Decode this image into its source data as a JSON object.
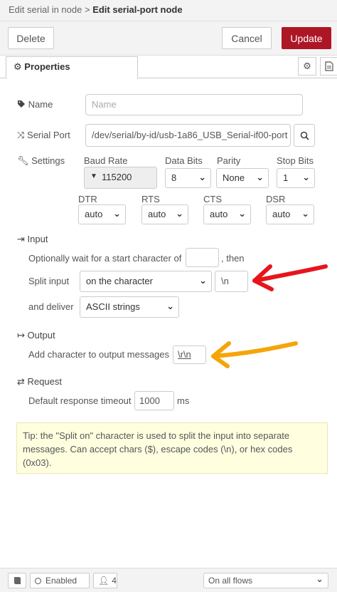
{
  "breadcrumb": {
    "parent": "Edit serial in node",
    "separator": ">",
    "current": "Edit serial-port node"
  },
  "toolbar": {
    "delete_label": "Delete",
    "cancel_label": "Cancel",
    "update_label": "Update"
  },
  "tabs": {
    "properties_label": "Properties"
  },
  "name": {
    "label": "Name",
    "placeholder": "Name",
    "value": ""
  },
  "serial_port": {
    "label": "Serial Port",
    "value": "/dev/serial/by-id/usb-1a86_USB_Serial-if00-port"
  },
  "settings": {
    "label": "Settings",
    "baud_rate": {
      "label": "Baud Rate",
      "value": "115200"
    },
    "data_bits": {
      "label": "Data Bits",
      "value": "8"
    },
    "parity": {
      "label": "Parity",
      "value": "None"
    },
    "stop_bits": {
      "label": "Stop Bits",
      "value": "1"
    },
    "dtr": {
      "label": "DTR",
      "value": "auto"
    },
    "rts": {
      "label": "RTS",
      "value": "auto"
    },
    "cts": {
      "label": "CTS",
      "value": "auto"
    },
    "dsr": {
      "label": "DSR",
      "value": "auto"
    }
  },
  "input": {
    "heading": "Input",
    "wait_prefix": "Optionally wait for a start character of",
    "wait_suffix": ", then",
    "wait_value": "",
    "split_label": "Split input",
    "split_value": "on the character",
    "split_char": "\\n",
    "deliver_label": "and deliver",
    "deliver_value": "ASCII strings"
  },
  "output": {
    "heading": "Output",
    "add_char_label": "Add character to output messages",
    "add_char_value": "\\r\\n"
  },
  "request": {
    "heading": "Request",
    "timeout_label": "Default response timeout",
    "timeout_value": "1000",
    "timeout_unit": "ms"
  },
  "tip": {
    "text": "Tip: the \"Split on\" character is used to split the input into separate messages. Can accept chars ($), escape codes (\\n), or hex codes (0x03)."
  },
  "footer": {
    "enabled_label": "Enabled",
    "user_count": "4",
    "scope_value": "On all flows"
  },
  "annotations": {
    "red_arrow_color": "#e8141c",
    "orange_arrow_color": "#f5a50a"
  },
  "colors": {
    "accent": "#ad1625"
  }
}
